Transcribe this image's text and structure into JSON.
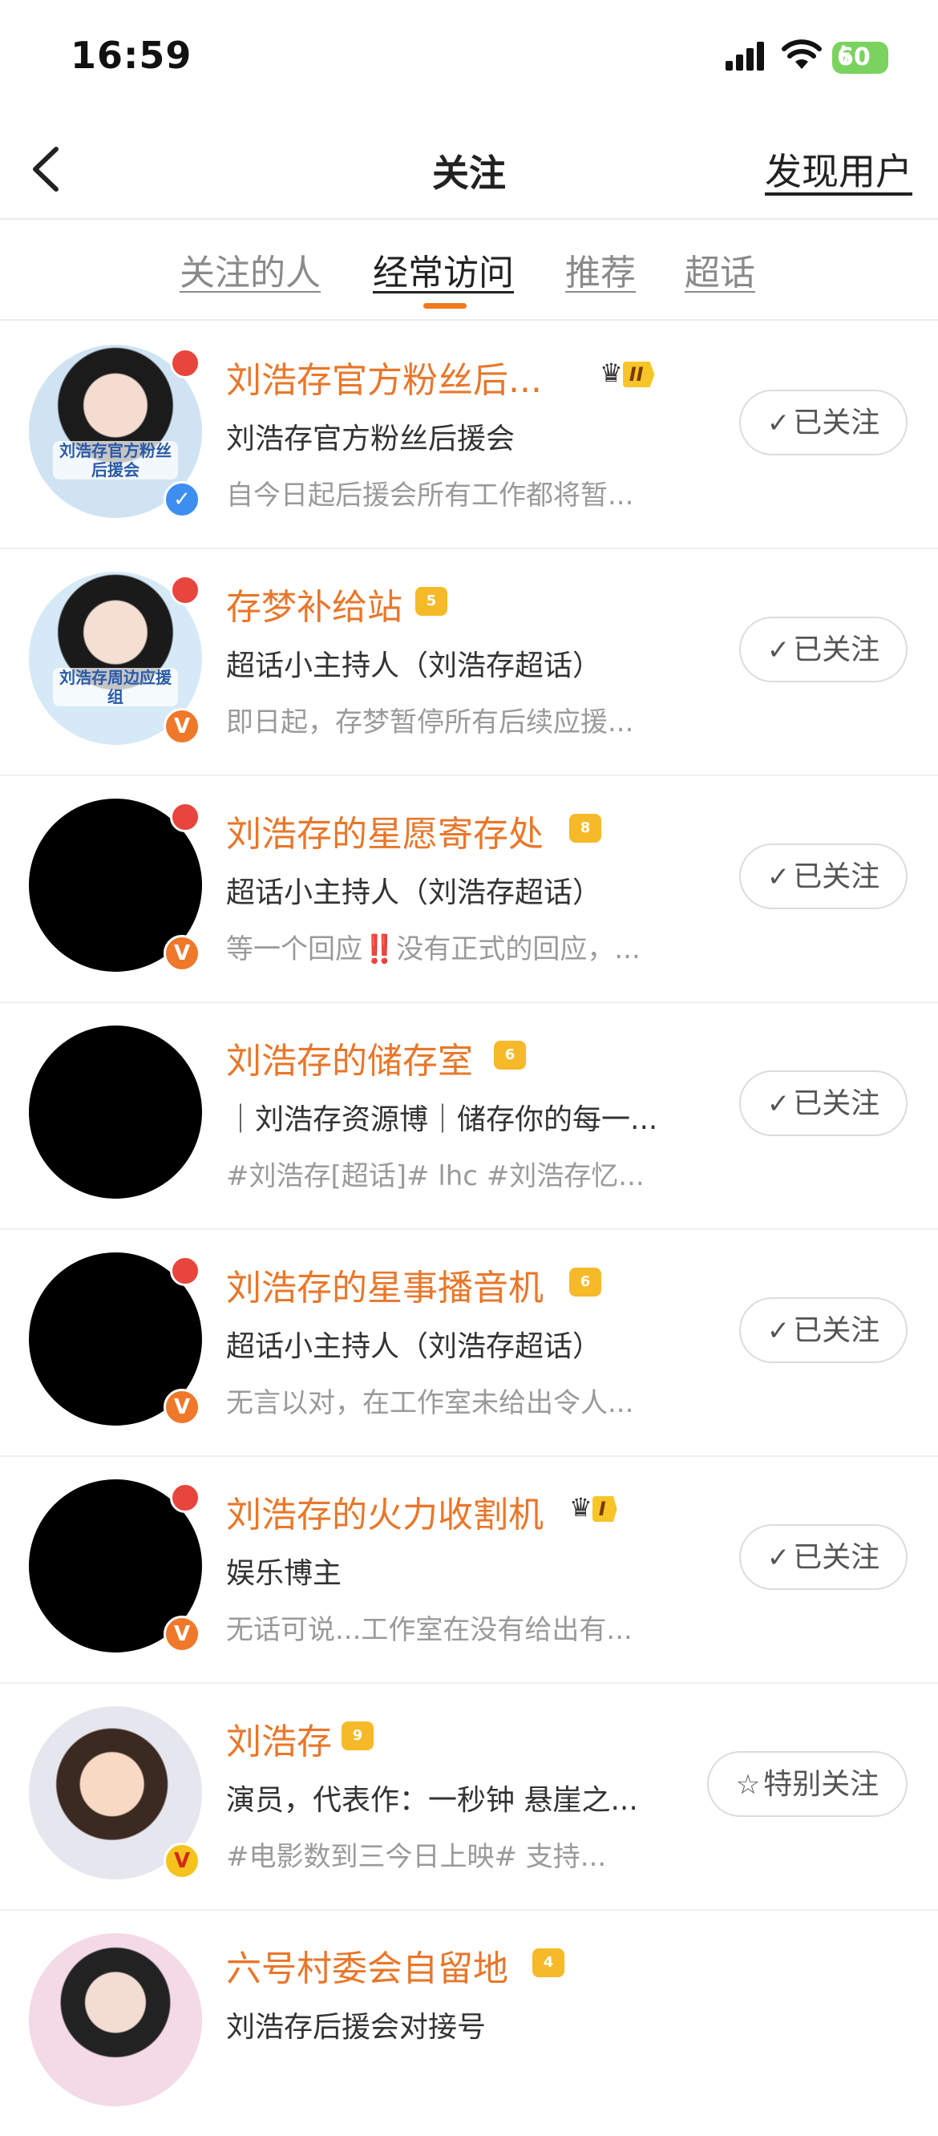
{
  "status_bar": {
    "time": "16:59",
    "battery": "60"
  },
  "nav": {
    "title": "关注",
    "discover": "发现用户"
  },
  "tabs": [
    {
      "label": "关注的人"
    },
    {
      "label": "经常访问"
    },
    {
      "label": "推荐"
    },
    {
      "label": "超话"
    }
  ],
  "colors": {
    "accent": "#f07a1e",
    "name": "#e8772a",
    "unread": "#e8453c",
    "verify_blue": "#3d8ef0",
    "verify_orange": "#f0782a"
  },
  "users": [
    {
      "name": "刘浩存官方粉丝后...",
      "crown": "II",
      "desc": "刘浩存官方粉丝后援会",
      "sub": "自今日起后援会所有工作都将暂...",
      "button": "已关注",
      "button_icon": "check-icon",
      "avatar_caption": "刘浩存官方粉丝后援会",
      "verify": "blue"
    },
    {
      "name": "存梦补给站",
      "crown": "5",
      "desc": "超话小主持人（刘浩存超话）",
      "sub": "即日起，存梦暂停所有后续应援...",
      "button": "已关注",
      "button_icon": "check-icon",
      "avatar_caption": "刘浩存周边应援组",
      "verify": "orange"
    },
    {
      "name": "刘浩存的星愿寄存处",
      "crown": "8",
      "desc": "超话小主持人（刘浩存超话）",
      "sub": "等一个回应‼️没有正式的回应，...",
      "button": "已关注",
      "button_icon": "check-icon",
      "verify": "orange"
    },
    {
      "name": "刘浩存的储存室",
      "crown": "6",
      "desc": "｜刘浩存资源博｜储存你的每一...",
      "sub": "#刘浩存[超话]# lhc #刘浩存忆...",
      "button": "已关注",
      "button_icon": "check-icon"
    },
    {
      "name": "刘浩存的星事播音机",
      "crown": "6",
      "desc": "超话小主持人（刘浩存超话）",
      "sub": "无言以对，在工作室未给出令人...",
      "button": "已关注",
      "button_icon": "check-icon",
      "verify": "orange"
    },
    {
      "name": "刘浩存的火力收割机",
      "crown": "I",
      "desc": "娱乐博主",
      "sub": "无话可说...工作室在没有给出有...",
      "button": "已关注",
      "button_icon": "check-icon",
      "verify": "orange"
    },
    {
      "name": "刘浩存",
      "crown": "9",
      "desc": "演员，代表作：一秒钟 悬崖之...",
      "sub": "#电影数到三今日上映# 支持...",
      "button": "特别关注",
      "button_icon": "star-icon",
      "verify": "gold"
    },
    {
      "name": "六号村委会自留地",
      "crown": "4",
      "desc": "刘浩存后援会对接号"
    }
  ]
}
